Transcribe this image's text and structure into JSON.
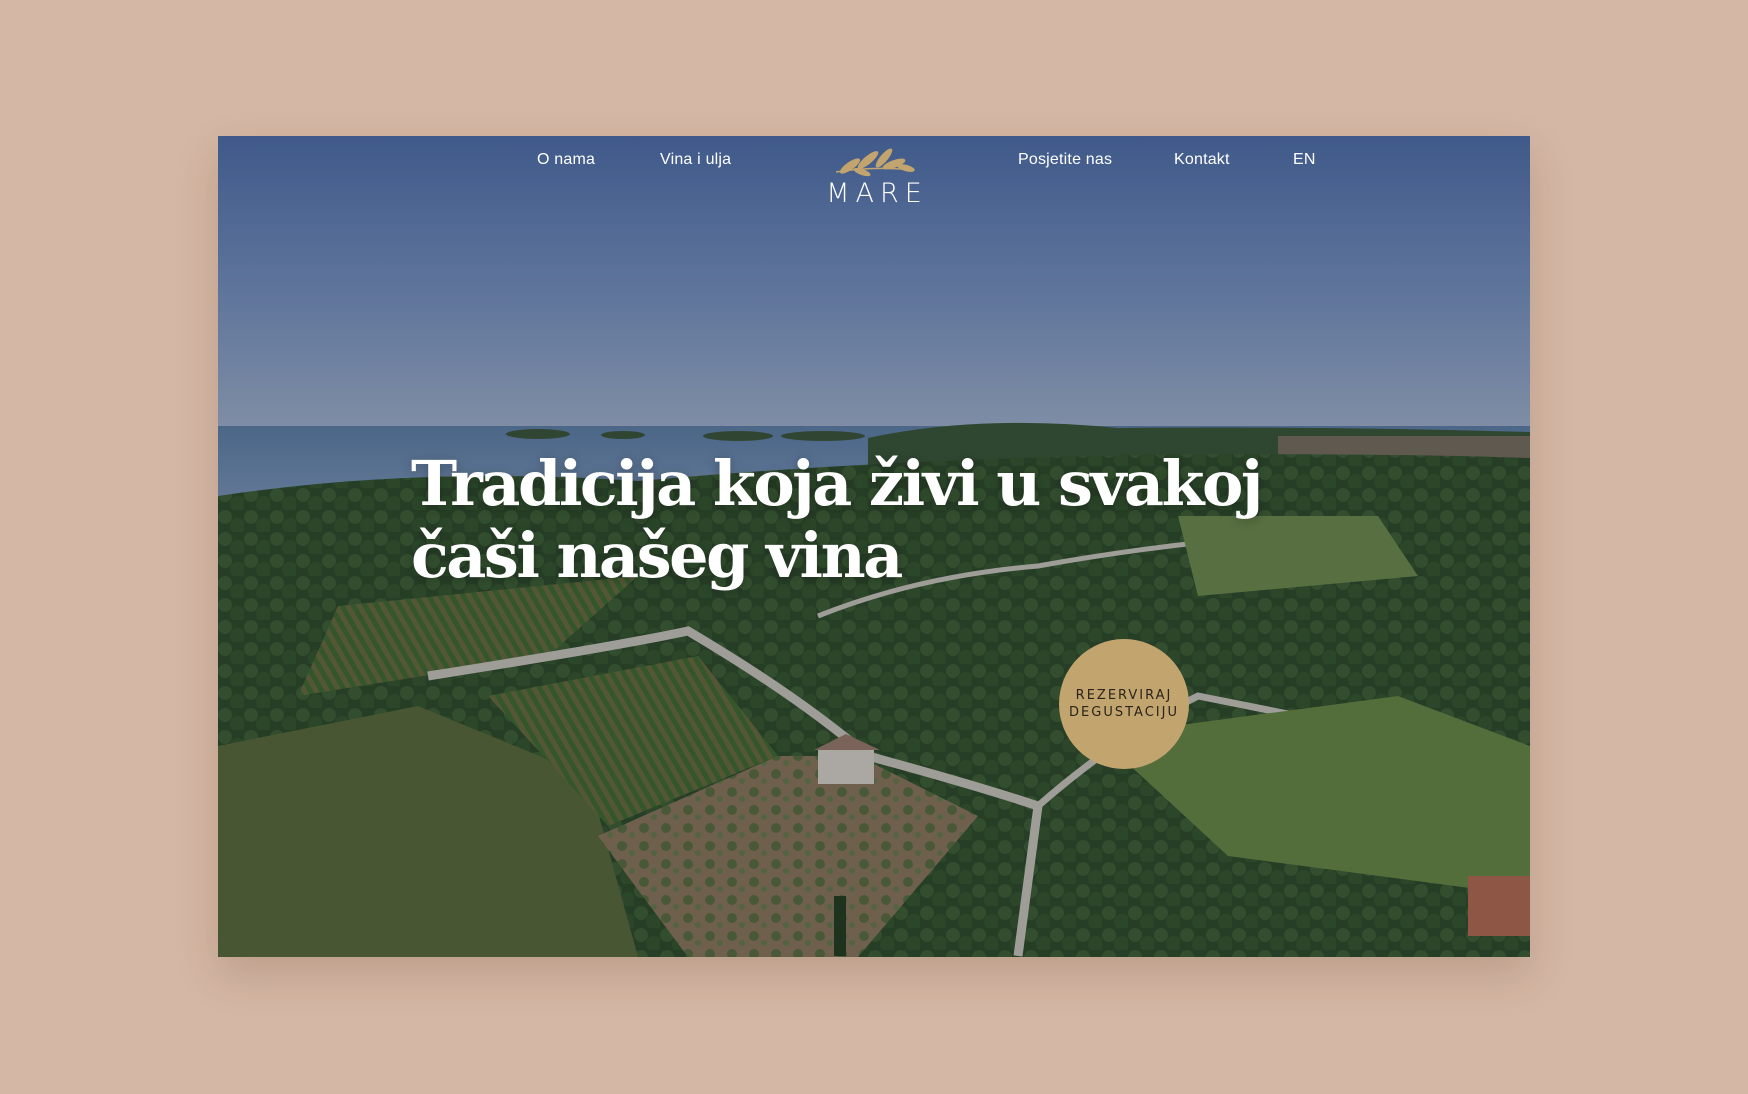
{
  "nav": {
    "items": [
      {
        "label": "O nama"
      },
      {
        "label": "Vina i ulja"
      },
      {
        "label": "Posjetite nas"
      },
      {
        "label": "Kontakt"
      },
      {
        "label": "EN"
      }
    ]
  },
  "logo": {
    "text": "MARE",
    "icon": "olive-branch-icon"
  },
  "hero": {
    "title": "Tradicija koja živi u svakoj čaši našeg vina",
    "cta_label": "REZERVIRAJ DEGUSTACIJU"
  },
  "colors": {
    "background": "#d4b7a4",
    "accent_gold": "#c2a46e",
    "text": "#ffffff"
  }
}
